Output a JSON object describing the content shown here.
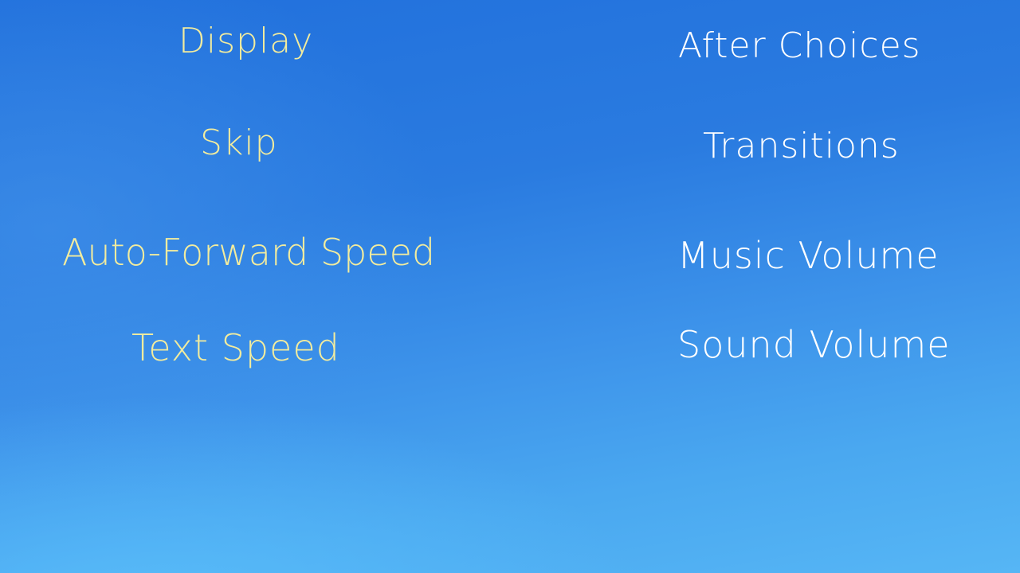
{
  "preferences": {
    "left_column": {
      "display": "Display",
      "skip": "Skip",
      "auto_forward_speed": "Auto-Forward Speed",
      "text_speed": "Text Speed"
    },
    "right_column": {
      "after_choices": "After Choices",
      "transitions": "Transitions",
      "music_volume": "Music Volume",
      "sound_volume": "Sound Volume"
    }
  },
  "colors": {
    "background_top": "#2170dc",
    "background_bottom": "#56b6f5",
    "left_label_color": "#f2ec9e",
    "right_label_color": "#ffffff"
  }
}
